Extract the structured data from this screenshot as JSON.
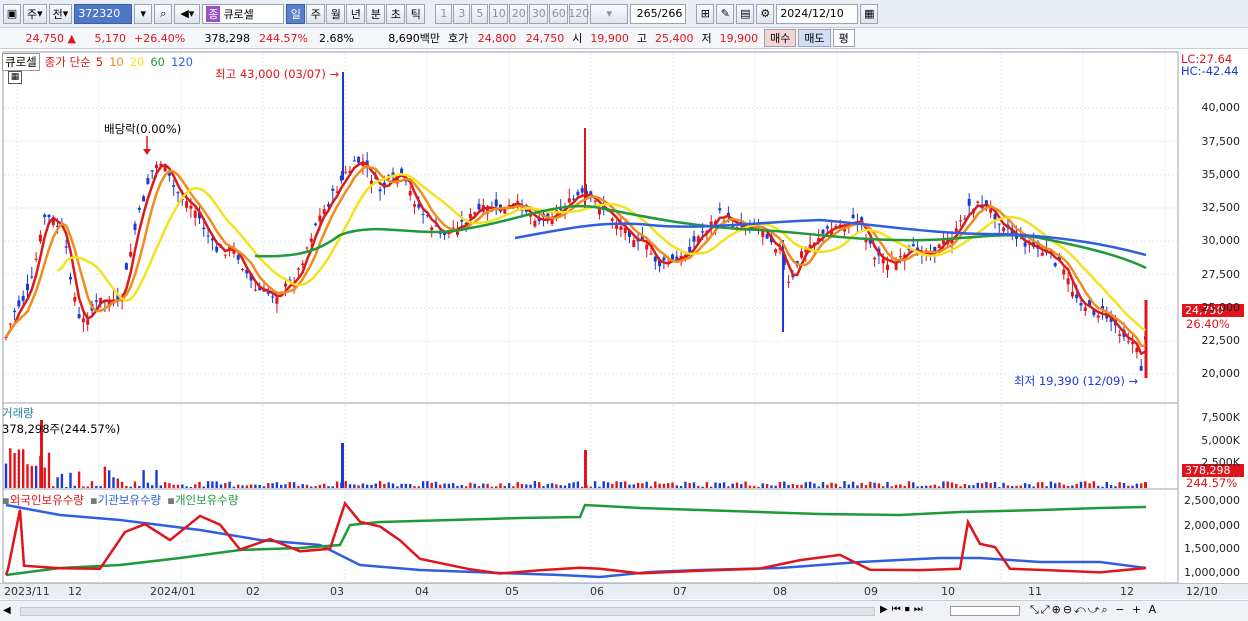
{
  "toolbar": {
    "type_select": "주",
    "mode": "전",
    "code": "372320",
    "stock_name": "큐로셀",
    "stock_badge": "종",
    "periods": [
      "일",
      "주",
      "월",
      "년",
      "분",
      "초",
      "틱"
    ],
    "active_period": "일",
    "intervals": [
      "1",
      "3",
      "5",
      "10",
      "20",
      "30",
      "60",
      "120"
    ],
    "count": "265",
    "count_total": "/266",
    "date": "2024/12/10"
  },
  "quote": {
    "price": "24,750",
    "change": "5,170",
    "change_pct": "+26.40%",
    "volume": "378,298",
    "volume_ratio": "244.57%",
    "turnover": "2.68%",
    "amount": "8,690백만",
    "ask_label": "호가",
    "ask": "24,800",
    "bid": "24,750",
    "open_label": "시",
    "open": "19,900",
    "high_label": "고",
    "high": "25,400",
    "low_label": "저",
    "low": "19,900",
    "buy": "매수",
    "sell": "매도",
    "eval": "평"
  },
  "price_panel": {
    "name": "큐로셀",
    "indicator": "종가 단순",
    "ma_periods": [
      "5",
      "10",
      "20",
      "60",
      "120"
    ],
    "ma_colors": [
      "#d81b1b",
      "#f08c1c",
      "#f5e11e",
      "#1f9a3a",
      "#2f5fe0"
    ],
    "high_note": "최고 43,000 (03/07)",
    "low_note": "최저 19,390 (12/09)",
    "dividend_note": "배당락(0.00%)",
    "lc": "LC:27.64",
    "hc": "HC:-42.44",
    "y_labels": [
      "40,000",
      "37,500",
      "35,000",
      "32,500",
      "30,000",
      "27,500",
      "25,000",
      "22,500",
      "20,000"
    ],
    "last_price": "24,750",
    "last_pct": "26.40%"
  },
  "volume_panel": {
    "title": "거래량",
    "value": "378,298주(244.57%)",
    "y_labels": [
      "7,500K",
      "5,000K",
      "2,500K"
    ],
    "last": "378,298",
    "last_pct": "244.57%"
  },
  "holding_panel": {
    "series": [
      "외국인보유수량",
      "기관보유수량",
      "개인보유수량"
    ],
    "colors": [
      "#e0141b",
      "#2f5fe0",
      "#1f9a3a"
    ],
    "y_labels": [
      "2,500,000",
      "2,000,000",
      "1,500,000",
      "1,000,000"
    ]
  },
  "x_axis": [
    "2023/11",
    "12",
    "2024/01",
    "02",
    "03",
    "04",
    "05",
    "06",
    "07",
    "08",
    "09",
    "10",
    "11",
    "12",
    "12/10"
  ]
}
